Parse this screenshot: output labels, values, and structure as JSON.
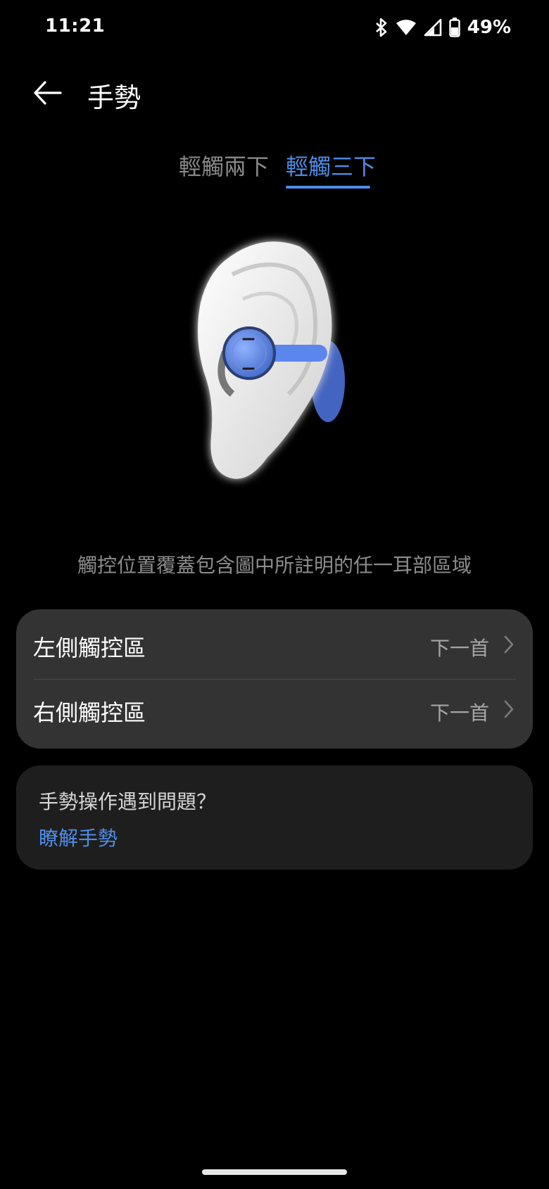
{
  "status_bar": {
    "time": "11:21",
    "battery_percent": "49%",
    "icons": [
      "bluetooth-icon",
      "wifi-icon",
      "cellular-signal-icon",
      "battery-icon"
    ]
  },
  "header": {
    "title": "手勢",
    "back_icon": "arrow-left-icon"
  },
  "tabs": [
    {
      "label": "輕觸兩下",
      "selected": false
    },
    {
      "label": "輕觸三下",
      "selected": true
    }
  ],
  "illustration": {
    "icon": "ear-with-earbud-illustration"
  },
  "hint": "觸控位置覆蓋包含圖中所註明的任一耳部區域",
  "settings": {
    "rows": [
      {
        "label": "左側觸控區",
        "value": "下一首"
      },
      {
        "label": "右側觸控區",
        "value": "下一首"
      }
    ]
  },
  "help": {
    "question": "手勢操作遇到問題？",
    "link": "瞭解手勢"
  },
  "colors": {
    "accent": "#4d8ee8",
    "background": "#000000",
    "card": "#333333",
    "help_card": "#1e1e1e"
  }
}
